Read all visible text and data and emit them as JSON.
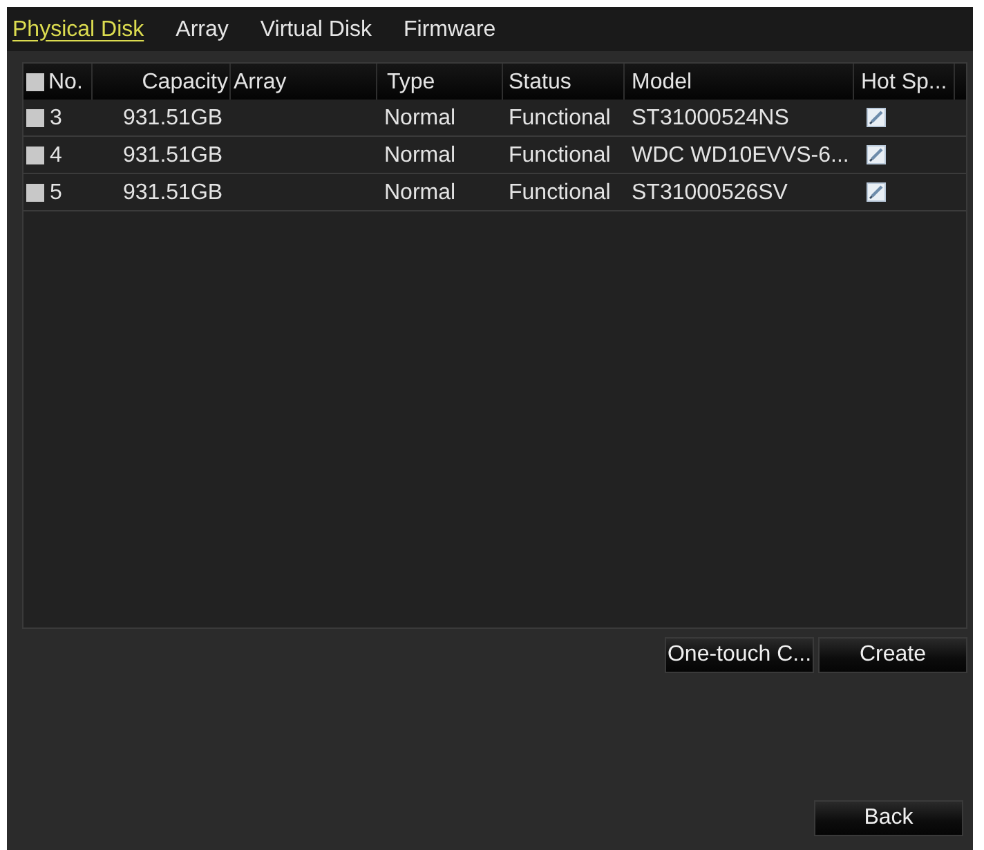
{
  "tabs": [
    {
      "label": "Physical Disk",
      "selected": true
    },
    {
      "label": "Array",
      "selected": false
    },
    {
      "label": "Virtual Disk",
      "selected": false
    },
    {
      "label": "Firmware",
      "selected": false
    }
  ],
  "table": {
    "select_all": {
      "checked": false
    },
    "columns": [
      "No.",
      "Capacity",
      "Array",
      "Type",
      "Status",
      "Model",
      "Hot Sp..."
    ],
    "rows": [
      {
        "checked": false,
        "no": "3",
        "capacity": "931.51GB",
        "type": "Normal",
        "status": "Functional",
        "model": "ST31000524NS"
      },
      {
        "checked": false,
        "no": "4",
        "capacity": "931.51GB",
        "type": "Normal",
        "status": "Functional",
        "model": "WDC WD10EVVS-6..."
      },
      {
        "checked": false,
        "no": "5",
        "capacity": "931.51GB",
        "type": "Normal",
        "status": "Functional",
        "model": "ST31000526SV"
      }
    ]
  },
  "actions": [
    "One-touch C...",
    "Create"
  ],
  "back_button": "Back"
}
